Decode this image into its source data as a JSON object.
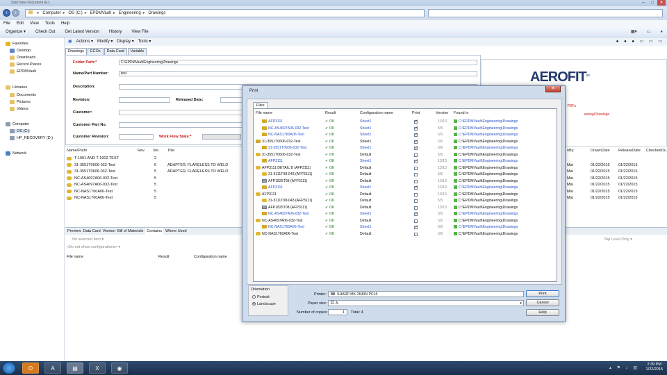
{
  "window": {
    "title": "Start New Document (E:)"
  },
  "address": {
    "crumbs": [
      "Computer",
      "OS (C:)",
      "EPDMVault",
      "Engineering",
      "Drawings"
    ]
  },
  "menu": [
    "File",
    "Edit",
    "View",
    "Tools",
    "Help"
  ],
  "commands": [
    "Organize ▾",
    "Check Out",
    "Get Latest Version",
    "History",
    "View File"
  ],
  "nav": {
    "favorites": "Favorites",
    "fav_items": [
      "Desktop",
      "Downloads",
      "Recent Places",
      "EPDMVault"
    ],
    "libraries": "Libraries",
    "lib_items": [
      "Documents",
      "Pictures",
      "Videos"
    ],
    "computer": "Computer",
    "comp_items": [
      "OS (C:)",
      "HP_RECOVERY (D:)"
    ],
    "network": "Network"
  },
  "toolbar2": [
    "Actions ▾",
    "Modify ▾",
    "Display ▾",
    "Tools ▾"
  ],
  "card_tabs": [
    "Drawings",
    "ECOs",
    "Data Card",
    "Variable"
  ],
  "form": {
    "folder_path_label": "Folder Path:*",
    "folder_path_value": "C:\\EPDMVault\\Engineering\\Drawings",
    "name_label": "Name/Part Number:",
    "name_value": "test",
    "description_label": "Description:",
    "revision_label": "Revision:",
    "released_label": "Released Date:",
    "customer_label": "Customer:",
    "customer_part_label": "Customer Part No.",
    "customer_rev_label": "Customer Revision:",
    "workflow_label": "Work Flow State:*"
  },
  "logo": {
    "text": "AEROFIT",
    "sub": "LLC",
    "pdf_note": "PDFs",
    "path_note": "eering\\Drawings"
  },
  "grid": {
    "headers": [
      "Name/Part#",
      "Rev.",
      "Ver.",
      "Title"
    ],
    "right_headers": [
      "nBy",
      "DrawnDate",
      "ReleaseDate",
      "CheckedOu"
    ],
    "rows": [
      {
        "name": "T-1001 AND T-1002 TEST",
        "ver": "2",
        "title": "",
        "by": "",
        "drawn": "",
        "rel": ""
      },
      {
        "name": "31-3551T0606-032-Test",
        "ver": "6",
        "title": "ADAPTER, FLARELESS TO WELD",
        "by": "Mai",
        "drawn": "01/22/2015",
        "rel": "01/22/2015"
      },
      {
        "name": "31-3551T0606-032-Test",
        "ver": "5",
        "title": "ADAPTER, FLARELESS TO WELD",
        "by": "Mai",
        "drawn": "01/22/2015",
        "rel": "01/22/2015"
      },
      {
        "name": "NC-AS4697A06-032-Test",
        "ver": "5",
        "title": "",
        "by": "Mai",
        "drawn": "01/22/2015",
        "rel": "01/22/2015"
      },
      {
        "name": "NC-AS4697A06-032-Test",
        "ver": "5",
        "title": "",
        "by": "Mai",
        "drawn": "01/22/2015",
        "rel": "01/22/2015"
      },
      {
        "name": "NC-NAS1760A06-Test",
        "ver": "5",
        "title": "",
        "by": "Mai",
        "drawn": "01/22/2015",
        "rel": "01/22/2015"
      },
      {
        "name": "NC-NAS1760A06-Test",
        "ver": "5",
        "title": "",
        "by": "Mai",
        "drawn": "01/22/2015",
        "rel": "01/22/2015"
      }
    ]
  },
  "bottom_tabs": [
    "Preview",
    "Data Card",
    "Version",
    "Bill of Materials",
    "Contains",
    "Where Used"
  ],
  "bottom": {
    "no_item": "No selected item ▾",
    "no_config": "<Do not show configurations> ▾",
    "col_file": "File name",
    "col_result": "Result",
    "col_config": "Configuration name",
    "top_level": "Top Level Only ▾"
  },
  "dialog": {
    "title": "Print",
    "close": "✕",
    "tab": "Files",
    "headers": [
      "File name",
      "Result",
      "Configuration name",
      "Print",
      "Version",
      "Found in"
    ],
    "rows": [
      {
        "name": "AFP3111",
        "ind": 1,
        "icon": "d",
        "blue": true,
        "cfg": "Sheet1",
        "chk": true,
        "ver": "13/13",
        "found": "C:\\EPDMVault\\Engineering\\Drawings"
      },
      {
        "name": "NC-AS4697A06-032-Test",
        "ind": 1,
        "icon": "d",
        "blue": true,
        "cfg": "Sheet1",
        "chk": true,
        "ver": "5/5",
        "found": "C:\\EPDMVault\\Engineering\\Drawings"
      },
      {
        "name": "NC-NAS1760A06-Test",
        "ind": 1,
        "icon": "d",
        "blue": true,
        "cfg": "Sheet1",
        "chk": true,
        "ver": "5/5",
        "found": "C:\\EPDMVault\\Engineering\\Drawings"
      },
      {
        "name": "31-3551T0606-032-Test",
        "ind": 0,
        "icon": "d",
        "blue": false,
        "cfg": "Sheet1",
        "chk": true,
        "ver": "6/6",
        "found": "C:\\EPDMVault\\Engineering\\Drawings"
      },
      {
        "name": "31-3551T0606-032-Test",
        "ind": 1,
        "icon": "d",
        "blue": true,
        "cfg": "Sheet1",
        "chk": true,
        "ver": "6/6",
        "found": "C:\\EPDMVault\\Engineering\\Drawings"
      },
      {
        "name": "31-3551T0606-032-Test",
        "ind": 0,
        "icon": "a",
        "blue": false,
        "cfg": "Default",
        "chk": false,
        "ver": "5/5",
        "found": "C:\\EPDMVault\\Engineering\\Drawings"
      },
      {
        "name": "AFP3111",
        "ind": 1,
        "icon": "d",
        "blue": true,
        "cfg": "Sheet1",
        "chk": true,
        "ver": "13/13",
        "found": "C:\\EPDMVault\\Engineering\\Drawings"
      },
      {
        "name": "AFP3111 DETAIL B (AFP3111)",
        "ind": 0,
        "icon": "a",
        "blue": false,
        "cfg": "Default",
        "chk": false,
        "ver": "13/13",
        "found": "C:\\EPDMVault\\Engineering\\Drawings"
      },
      {
        "name": "31-3111T08-043 (AFP3111)",
        "ind": 1,
        "icon": "a",
        "blue": false,
        "cfg": "Default",
        "chk": false,
        "ver": "5/5",
        "found": "C:\\EPDMVault\\Engineering\\Drawings"
      },
      {
        "name": "AFP1825T08 (AFP3111)",
        "ind": 1,
        "icon": "p",
        "blue": false,
        "cfg": "Default",
        "chk": false,
        "ver": "13/13",
        "found": "C:\\EPDMVault\\Engineering\\Drawings"
      },
      {
        "name": "AFP3111",
        "ind": 1,
        "icon": "d",
        "blue": true,
        "cfg": "Sheet1",
        "chk": true,
        "ver": "13/13",
        "found": "C:\\EPDMVault\\Engineering\\Drawings"
      },
      {
        "name": "AFP3111",
        "ind": 0,
        "icon": "a",
        "blue": false,
        "cfg": "Default",
        "chk": false,
        "ver": "13/13",
        "found": "C:\\EPDMVault\\Engineering\\Drawings"
      },
      {
        "name": "31-3111T08-043 (AFP3111)",
        "ind": 1,
        "icon": "a",
        "blue": false,
        "cfg": "Default",
        "chk": false,
        "ver": "5/5",
        "found": "C:\\EPDMVault\\Engineering\\Drawings"
      },
      {
        "name": "AFP1825T08 (AFP3111)",
        "ind": 1,
        "icon": "p",
        "blue": false,
        "cfg": "Default",
        "chk": false,
        "ver": "13/13",
        "found": "C:\\EPDMVault\\Engineering\\Drawings"
      },
      {
        "name": "NC-AS4697A06-032-Test",
        "ind": 1,
        "icon": "d",
        "blue": true,
        "cfg": "Sheet1",
        "chk": true,
        "ver": "5/5",
        "found": "C:\\EPDMVault\\Engineering\\Drawings"
      },
      {
        "name": "NC-AS4697A06-032-Test",
        "ind": 0,
        "icon": "a",
        "blue": false,
        "cfg": "Default",
        "chk": false,
        "ver": "5/5",
        "found": "C:\\EPDMVault\\Engineering\\Drawings"
      },
      {
        "name": "NC-NAS1760A06-Test",
        "ind": 1,
        "icon": "d",
        "blue": true,
        "cfg": "Sheet1",
        "chk": true,
        "ver": "5/5",
        "found": "C:\\EPDMVault\\Engineering\\Drawings"
      },
      {
        "name": "NC-NAS1760A06-Test",
        "ind": 0,
        "icon": "a",
        "blue": false,
        "cfg": "Default",
        "chk": false,
        "ver": "5/5",
        "found": "C:\\EPDMVault\\Engineering\\Drawings"
      }
    ],
    "ok": "OK",
    "orientation": "Orientation",
    "portrait": "Portrait",
    "landscape": "Landscape",
    "printer_label": "Printer:",
    "printer_value": "SHARP MX-2640N PCL6",
    "paper_label": "Paper size:",
    "paper_value": "A",
    "copies_label": "Number of copies:",
    "copies_value": "1",
    "total": "Total: 4",
    "print_btn": "Print",
    "cancel_btn": "Cancel",
    "help_btn": "Help"
  },
  "taskbar": {
    "time": "2:39 PM",
    "date": "1/22/2015"
  }
}
